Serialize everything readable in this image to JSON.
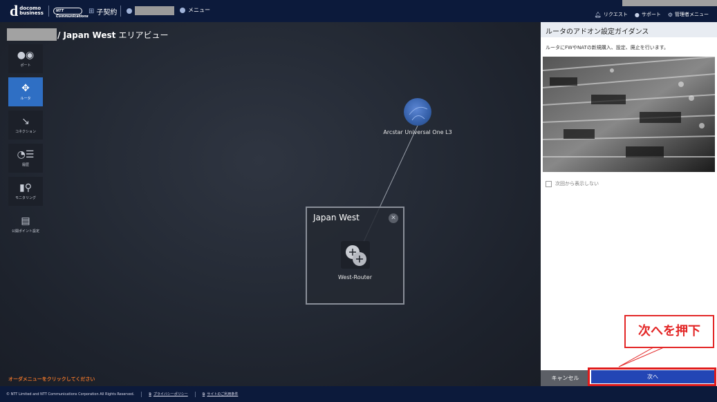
{
  "header": {
    "logo_letter": "d",
    "logo_line1": "docomo",
    "logo_line2": "business",
    "ntt_logo": "NTT Communications",
    "contract_label": "子契約",
    "menu_label": "メニュー",
    "request_label": "リクエスト",
    "support_label": "サポート",
    "admin_menu_label": "管理者メニュー"
  },
  "breadcrumb": {
    "area_name": "/ Japan West",
    "view_label": "エリアビュー"
  },
  "sidebar": {
    "items": [
      {
        "label": "ポート",
        "icon": "port-icon"
      },
      {
        "label": "ルータ",
        "icon": "router-icon"
      },
      {
        "label": "コネクション",
        "icon": "connection-icon"
      },
      {
        "label": "履歴",
        "icon": "history-icon"
      },
      {
        "label": "モニタリング",
        "icon": "monitoring-icon"
      },
      {
        "label": "公開ポイント設定",
        "icon": "public-point-icon"
      }
    ]
  },
  "diagram": {
    "cloud_node_label": "Arcstar Universal One L3",
    "region_title": "Japan West",
    "router_label": "West-Router"
  },
  "order_message": "オーダメニューをクリックしてください",
  "panel": {
    "title": "ルータのアドオン設定ガイダンス",
    "description": "ルータにFWやNATの新規購入、設定、廃止を行います。",
    "checkbox_label": "次回から表示しない",
    "cancel_label": "キャンセル",
    "next_label": "次へ"
  },
  "callout_text": "次へを押下",
  "footer": {
    "copyright": "© NTT Limited and NTT Communications Corporation All Rights Reserved.",
    "privacy_label": "プライバシーポリシー",
    "terms_label": "サイトのご利用条件"
  },
  "colors": {
    "header_bg": "#0c1a3b",
    "active_item": "#2f6fc4",
    "next_button": "#2346b5",
    "highlight_red": "#e01b1b"
  }
}
